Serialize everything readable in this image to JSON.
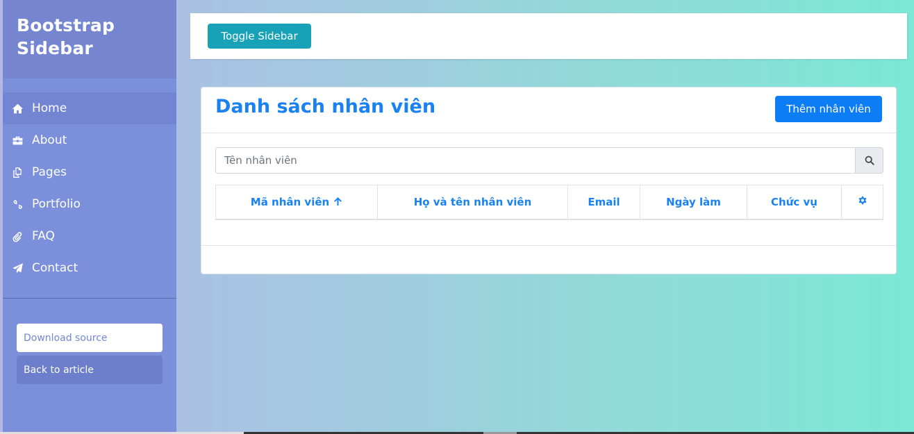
{
  "sidebar": {
    "title_line1": "Bootstrap",
    "title_line2": "Sidebar",
    "items": [
      {
        "label": "Home",
        "icon": "home-icon"
      },
      {
        "label": "About",
        "icon": "briefcase-icon"
      },
      {
        "label": "Pages",
        "icon": "copy-icon"
      },
      {
        "label": "Portfolio",
        "icon": "link-icon"
      },
      {
        "label": "FAQ",
        "icon": "paperclip-icon"
      },
      {
        "label": "Contact",
        "icon": "paper-plane-icon"
      }
    ],
    "download_label": "Download source",
    "back_label": "Back to article"
  },
  "topbar": {
    "toggle_label": "Toggle Sidebar"
  },
  "card": {
    "title": "Danh sách nhân viên",
    "add_label": "Thêm nhân viên",
    "search_placeholder": "Tên nhân viên",
    "columns": [
      "Mã nhân viên",
      "Họ và tên nhân viên",
      "Email",
      "Ngày làm",
      "Chức vụ"
    ]
  },
  "colors": {
    "sidebar_bg": "#7b8fda",
    "accent_blue": "#1a82f0",
    "toggle_teal": "#17a2b8"
  }
}
